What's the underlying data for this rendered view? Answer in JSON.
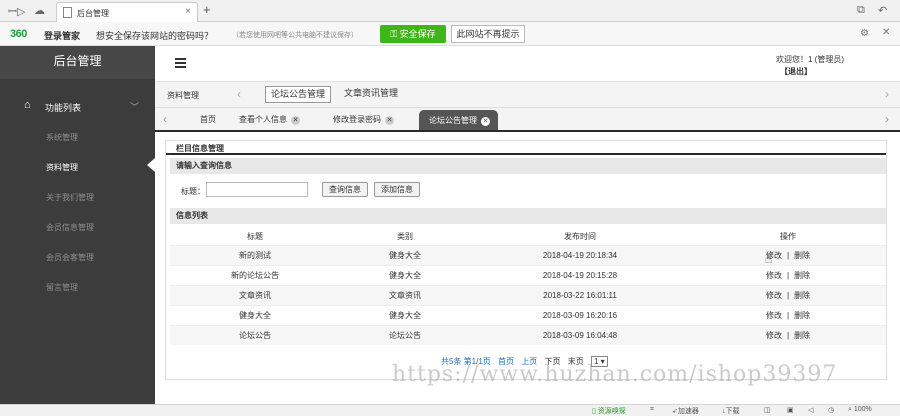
{
  "browser": {
    "tab_title": "后台管理",
    "tab_close": "×",
    "new_tab": "+",
    "nav_icons": [
      "back-forward-icon",
      "cloud-icon"
    ],
    "window_icons": [
      "restore-icon",
      "undo-icon"
    ]
  },
  "password_bar": {
    "logo": "360",
    "brand": "登录管家",
    "question": "想安全保存该网站的密码吗？",
    "note": "（若您使用网吧等公共电脑不建议保存）",
    "save_label": "安全保存",
    "never_label": "此网站不再提示"
  },
  "sidebar": {
    "title": "后台管理",
    "group_label": "功能列表",
    "items": [
      {
        "label": "系统管理",
        "active": false
      },
      {
        "label": "资料管理",
        "active": true
      },
      {
        "label": "关于我们管理",
        "active": false
      },
      {
        "label": "会员信息管理",
        "active": false
      },
      {
        "label": "会员会客管理",
        "active": false
      },
      {
        "label": "留言管理",
        "active": false
      }
    ]
  },
  "header": {
    "welcome": "欢迎您！1 (管理员)",
    "logout": "【退出】"
  },
  "module_bar": {
    "current": "资料管理",
    "modules": [
      "论坛公告管理",
      "文章资讯管理"
    ]
  },
  "page_tabs": [
    {
      "label": "首页",
      "closable": false,
      "active": false
    },
    {
      "label": "查看个人信息",
      "closable": true,
      "active": false
    },
    {
      "label": "修改登录密码",
      "closable": true,
      "active": false
    },
    {
      "label": "论坛公告管理",
      "closable": true,
      "active": true
    }
  ],
  "panel": {
    "title": "栏目信息管理",
    "search_section": "请输入查询信息",
    "search_label": "标题：",
    "search_value": "",
    "query_button": "查询信息",
    "add_button": "添加信息",
    "list_section": "信息列表",
    "columns": [
      "标题",
      "类别",
      "发布时间",
      "操作"
    ],
    "rows": [
      {
        "title": "新的测试",
        "category": "健身大全",
        "time": "2018-04-19 20:18:34"
      },
      {
        "title": "新的论坛公告",
        "category": "健身大全",
        "time": "2018-04-19 20:15:28"
      },
      {
        "title": "文章资讯",
        "category": "文章资讯",
        "time": "2018-03-22 16:01:11"
      },
      {
        "title": "健身大全",
        "category": "健身大全",
        "time": "2018-03-09 16:20:16"
      },
      {
        "title": "论坛公告",
        "category": "论坛公告",
        "time": "2018-03-09 16:04:48"
      }
    ],
    "edit_label": "修改",
    "delete_label": "删除",
    "op_separator": "|"
  },
  "pager": {
    "summary": "共5条 第1/1页",
    "first": "首页",
    "prev": "上页",
    "next": "下页",
    "last": "末页",
    "page_value": "1 ▾"
  },
  "watermark": "https://www.huzhan.com/ishop39397",
  "status_bar": {
    "items": [
      "资源嗅探",
      "加速器",
      "下载",
      "100%"
    ]
  }
}
